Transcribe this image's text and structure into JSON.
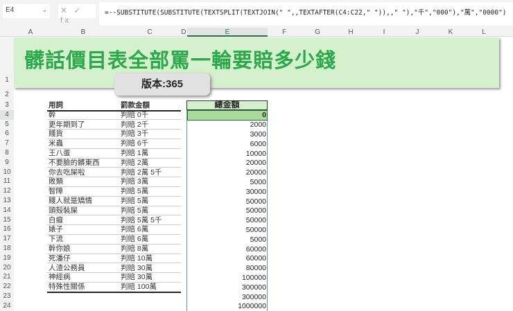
{
  "toolbar": {
    "name_box": "E4",
    "fx_icons": "✕ ✓ fx",
    "formula": "=--SUBSTITUTE(SUBSTITUTE(TEXTSPLIT(TEXTJOIN(\" \",,TEXTAFTER(C4:C22,\" \")),,\" \"),\"千\",\"000\"),\"萬\",\"0000\")"
  },
  "columns": [
    "A",
    "B",
    "C",
    "D",
    "E",
    "F",
    "G",
    "H",
    "I",
    "J",
    "K",
    "L"
  ],
  "rows": [
    "1",
    "2",
    "3",
    "4",
    "5",
    "6",
    "7",
    "8",
    "9",
    "10",
    "11",
    "12",
    "13",
    "14",
    "15",
    "16",
    "17",
    "18",
    "19",
    "20",
    "21",
    "22",
    "23",
    "24"
  ],
  "banner": {
    "title": "髒話價目表全部罵一輪要賠多少錢",
    "version": "版本:365"
  },
  "table": {
    "headers": [
      "用詞",
      "罰款金額"
    ],
    "rows": [
      [
        "幹",
        "判賠 0千"
      ],
      [
        "更年期到了",
        "判賠 2千"
      ],
      [
        "賤貨",
        "判賠 3千"
      ],
      [
        "米蟲",
        "判賠 6千"
      ],
      [
        "王八蛋",
        "判賠 1萬"
      ],
      [
        "不要臉的髒東西",
        "判賠 2萬"
      ],
      [
        "你去吃屎啦",
        "判賠 2萬 5千"
      ],
      [
        "敗類",
        "判賠 3萬"
      ],
      [
        "智障",
        "判賠 5萬"
      ],
      [
        "賤人就是矯情",
        "判賠 5萬"
      ],
      [
        "頭殼裝屎",
        "判賠 5萬"
      ],
      [
        "白癡",
        "判賠 5萬 5千"
      ],
      [
        "婊子",
        "判賠 6萬"
      ],
      [
        "下流",
        "判賠 6萬"
      ],
      [
        "幹你娘",
        "判賠 8萬"
      ],
      [
        "死潘仔",
        "判賠 10萬"
      ],
      [
        "人渣公務員",
        "判賠 30萬"
      ],
      [
        "神經病",
        "判賠 30萬"
      ],
      [
        "特殊性關係",
        "判賠 100萬"
      ]
    ]
  },
  "total": {
    "header": "總金額",
    "values": [
      "0",
      "2000",
      "3000",
      "6000",
      "10000",
      "20000",
      "20000",
      "5000",
      "30000",
      "50000",
      "50000",
      "50000",
      "50000",
      "5000",
      "60000",
      "60000",
      "80000",
      "100000",
      "300000",
      "300000",
      "1000000"
    ]
  }
}
